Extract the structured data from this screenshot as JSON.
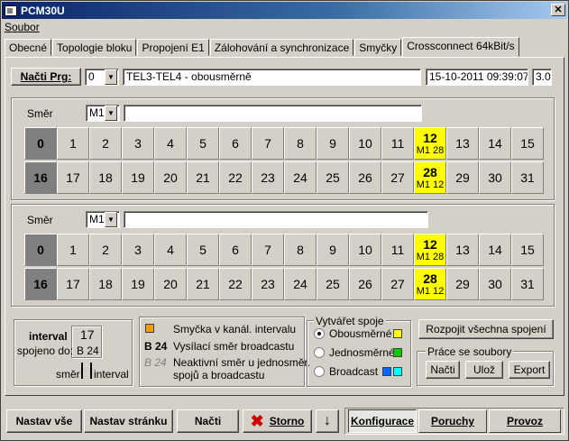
{
  "window": {
    "title": "PCM30U",
    "close": "✕"
  },
  "menu": {
    "file": "Soubor"
  },
  "tabs": [
    "Obecné",
    "Topologie bloku",
    "Propojení E1",
    "Zálohování a synchronizace",
    "Smyčky",
    "Crossconnect 64kBit/s"
  ],
  "active_tab": 5,
  "toolbar": {
    "load_prg": "Načti Prg:",
    "prg_number": "0",
    "description": "TEL3-TEL4 - obousměrně",
    "datetime": "15-10-2011 09:39:07",
    "version": "3.0"
  },
  "section1": {
    "direction_label": "Směr",
    "direction_value": "M1",
    "row1": [
      {
        "n": "0",
        "style": "dark"
      },
      {
        "n": "1"
      },
      {
        "n": "2"
      },
      {
        "n": "3"
      },
      {
        "n": "4"
      },
      {
        "n": "5"
      },
      {
        "n": "6"
      },
      {
        "n": "7"
      },
      {
        "n": "8"
      },
      {
        "n": "9"
      },
      {
        "n": "10"
      },
      {
        "n": "11"
      },
      {
        "n": "12",
        "style": "yellow",
        "sub": "M1 28"
      },
      {
        "n": "13"
      },
      {
        "n": "14"
      },
      {
        "n": "15"
      }
    ],
    "row2": [
      {
        "n": "16",
        "style": "dark"
      },
      {
        "n": "17"
      },
      {
        "n": "18"
      },
      {
        "n": "19"
      },
      {
        "n": "20"
      },
      {
        "n": "21"
      },
      {
        "n": "22"
      },
      {
        "n": "23"
      },
      {
        "n": "24"
      },
      {
        "n": "25"
      },
      {
        "n": "26"
      },
      {
        "n": "27"
      },
      {
        "n": "28",
        "style": "yellow",
        "sub": "M1 12"
      },
      {
        "n": "29"
      },
      {
        "n": "30"
      },
      {
        "n": "31"
      }
    ]
  },
  "section2": {
    "direction_label": "Směr",
    "direction_value": "M1",
    "row1": [
      {
        "n": "0",
        "style": "dark"
      },
      {
        "n": "1"
      },
      {
        "n": "2"
      },
      {
        "n": "3"
      },
      {
        "n": "4"
      },
      {
        "n": "5"
      },
      {
        "n": "6"
      },
      {
        "n": "7"
      },
      {
        "n": "8"
      },
      {
        "n": "9"
      },
      {
        "n": "10"
      },
      {
        "n": "11"
      },
      {
        "n": "12",
        "style": "yellow",
        "sub": "M1 28"
      },
      {
        "n": "13"
      },
      {
        "n": "14"
      },
      {
        "n": "15"
      }
    ],
    "row2": [
      {
        "n": "16",
        "style": "dark"
      },
      {
        "n": "17"
      },
      {
        "n": "18"
      },
      {
        "n": "19"
      },
      {
        "n": "20"
      },
      {
        "n": "21"
      },
      {
        "n": "22"
      },
      {
        "n": "23"
      },
      {
        "n": "24"
      },
      {
        "n": "25"
      },
      {
        "n": "26"
      },
      {
        "n": "27"
      },
      {
        "n": "28",
        "style": "yellow",
        "sub": "M1 12"
      },
      {
        "n": "29"
      },
      {
        "n": "30"
      },
      {
        "n": "31"
      }
    ]
  },
  "legend": {
    "interval_label": "interval",
    "interval_value": "17",
    "connected_label": "spojeno do:",
    "connected_value": "B 24",
    "direction_label": "směr",
    "interval_small": "interval",
    "loop_text": "Smyčka v kanál. intervalu",
    "broadcast_code": "B 24",
    "broadcast_text": "Vysílací směr broadcastu",
    "inactive_code": "B 24",
    "inactive_text_1": "Neaktivní směr u jednosměr.",
    "inactive_text_2": "spojů a broadcastu",
    "loop_color": "#ff9900"
  },
  "create": {
    "title": "Vytvářet spoje",
    "options": [
      {
        "label": "Obousměrné",
        "checked": true,
        "colors": [
          "#ffff00"
        ]
      },
      {
        "label": "Jednosměrné",
        "checked": false,
        "colors": [
          "#00cc00"
        ]
      },
      {
        "label": "Broadcast",
        "checked": false,
        "colors": [
          "#0066ff",
          "#00ffff"
        ]
      }
    ]
  },
  "actions": {
    "disconnect_all": "Rozpojit všechna spojení",
    "files_title": "Práce se soubory",
    "load": "Načti",
    "save": "Ulož",
    "export": "Export"
  },
  "bottom": {
    "set_all": "Nastav vše",
    "set_page": "Nastav stránku",
    "load": "Načti",
    "cancel": "Storno",
    "down": "↓",
    "config": "Konfigurace",
    "faults": "Poruchy",
    "operation": "Provoz"
  }
}
